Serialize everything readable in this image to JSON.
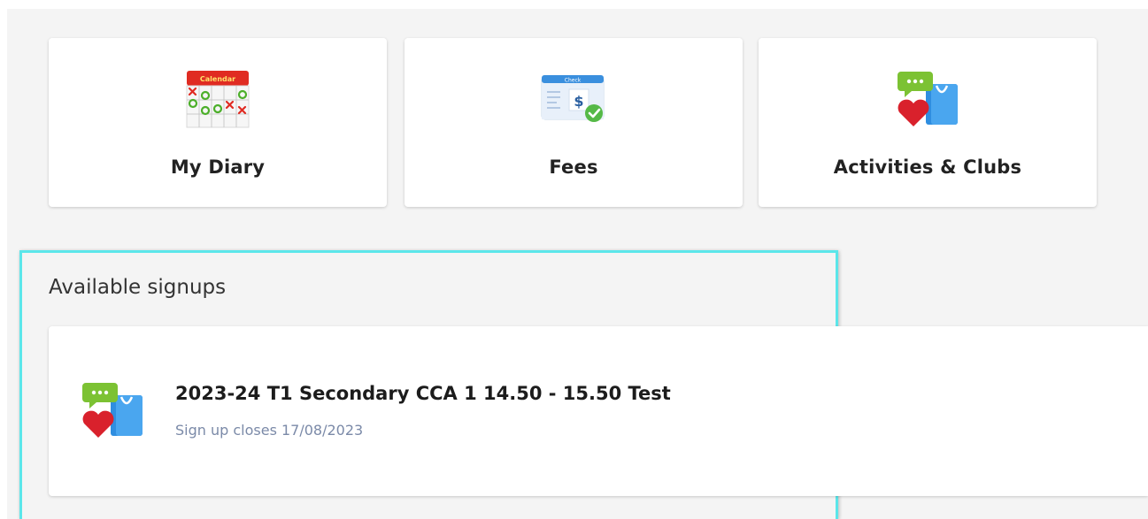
{
  "tiles": [
    {
      "label": "My Diary",
      "icon": "calendar-icon",
      "icon_header": "Calendar"
    },
    {
      "label": "Fees",
      "icon": "cheque-icon",
      "icon_header": "Check"
    },
    {
      "label": "Activities & Clubs",
      "icon": "activities-icon"
    }
  ],
  "signups": {
    "heading": "Available signups",
    "items": [
      {
        "title": "2023-24 T1 Secondary CCA 1 14.50 - 15.50 Test",
        "subtitle": "Sign up closes 17/08/2023",
        "icon": "activities-icon"
      }
    ]
  },
  "colors": {
    "page_background": "#f4f4f4",
    "highlight_border": "#5be6ea",
    "subtitle_text": "#7b8aa8",
    "calendar_red": "#e02b22",
    "cheque_blue": "#3a8fde",
    "bubble_green": "#7cc233",
    "heart_red": "#d9212c",
    "bag_blue": "#2f8ee0"
  }
}
